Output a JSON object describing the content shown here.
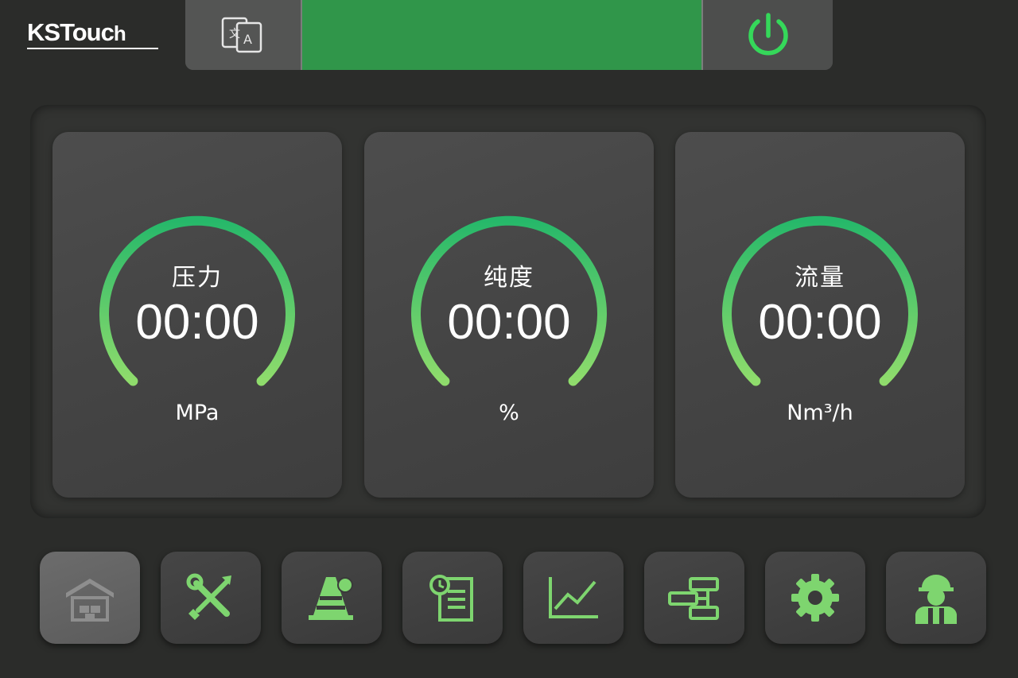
{
  "brand": {
    "logo_main": "KSTouc",
    "logo_tail": "h"
  },
  "colors": {
    "accent_green": "#30964a",
    "icon_green": "#7ed56f",
    "gauge_start": "#26b86a",
    "gauge_end": "#8fdc6c"
  },
  "header": {
    "language_icon": "language-translate-icon",
    "power_icon": "power-icon"
  },
  "gauges": [
    {
      "label": "压力",
      "value": "00:00",
      "unit": "MPa"
    },
    {
      "label": "纯度",
      "value": "00:00",
      "unit": "%"
    },
    {
      "label": "流量",
      "value": "00:00",
      "unit": "Nm³/h"
    }
  ],
  "nav": [
    {
      "icon": "home-warehouse-icon",
      "active": true
    },
    {
      "icon": "tools-icon"
    },
    {
      "icon": "alarm-icon"
    },
    {
      "icon": "history-record-icon"
    },
    {
      "icon": "trend-chart-icon"
    },
    {
      "icon": "flowchart-icon"
    },
    {
      "icon": "settings-gear-icon"
    },
    {
      "icon": "user-worker-icon"
    }
  ]
}
